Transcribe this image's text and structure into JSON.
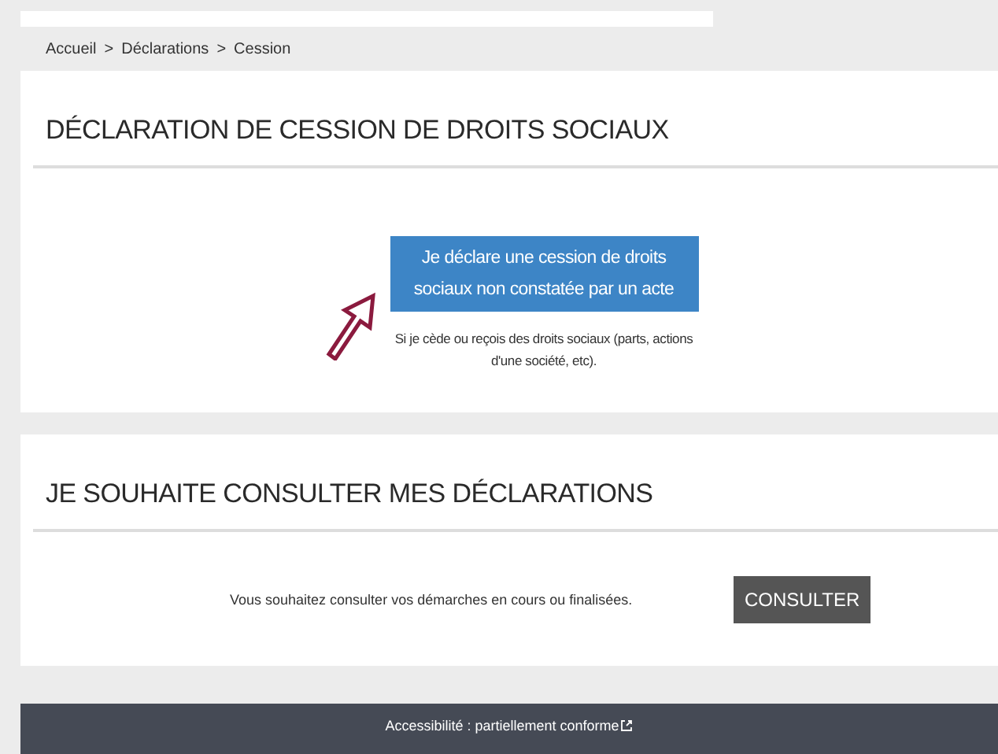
{
  "breadcrumb": [
    "Accueil",
    "Déclarations",
    "Cession"
  ],
  "breadcrumb_separator": ">",
  "declaration_section": {
    "title": "DÉCLARATION DE CESSION DE DROITS SOCIAUX",
    "button": "Je déclare une cession de droits sociaux non constatée par un acte",
    "description": "Si je cède ou reçois des droits sociaux (parts, actions d'une société, etc)."
  },
  "consult_section": {
    "title": "JE SOUHAITE CONSULTER MES DÉCLARATIONS",
    "text": "Vous souhaitez consulter vos démarches en cours ou finalisées.",
    "button": "CONSULTER"
  },
  "footer": {
    "link": "Accessibilité : partiellement conforme"
  }
}
